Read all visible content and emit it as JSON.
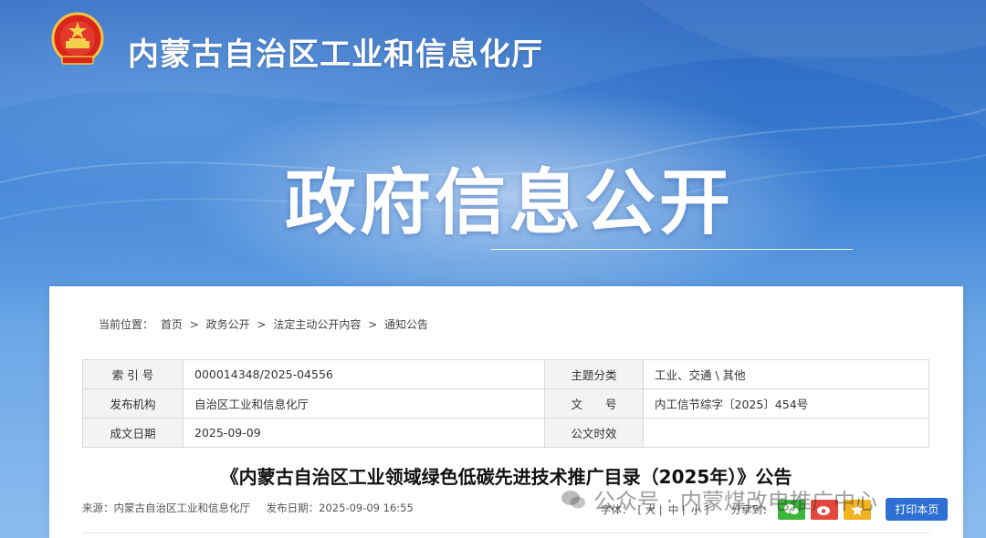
{
  "header": {
    "site_title": "内蒙古自治区工业和信息化厅",
    "hero_title": "政府信息公开"
  },
  "breadcrumb": {
    "prefix": "当前位置：",
    "items": [
      "首页",
      "政务公开",
      "法定主动公开内容",
      "通知公告"
    ],
    "separator": ">"
  },
  "info_table": {
    "rows": [
      {
        "label1": "索 引 号",
        "value1": "000014348/2025-04556",
        "label2": "主题分类",
        "value2": "工业、交通 \\ 其他"
      },
      {
        "label1": "发布机构",
        "value1": "自治区工业和信息化厅",
        "label2": "文　　号",
        "value2": "内工信节综字〔2025〕454号"
      },
      {
        "label1": "成文日期",
        "value1": "2025-09-09",
        "label2": "公文时效",
        "value2": ""
      }
    ]
  },
  "document": {
    "title": "《内蒙古自治区工业领域绿色低碳先进技术推广目录（2025年）》公告",
    "source": "来源：内蒙古自治区工业和信息化厅",
    "publish_date": "发布日期：2025-09-09 16:55"
  },
  "tools": {
    "font_label": "字体：",
    "font_large": "[ 大 |",
    "font_medium": "中 |",
    "font_small": "小 ]",
    "share_label": "分享到：",
    "print_label": "打印本页"
  },
  "watermark": {
    "text": "公众号 · 内蒙煤改电推广中心"
  },
  "colors": {
    "banner_blue": "#2f6cc4",
    "print_button": "#2d6fd2",
    "wechat_green": "#3eb53b",
    "weibo_red": "#e5473c",
    "qzone_yellow": "#f2b320"
  }
}
